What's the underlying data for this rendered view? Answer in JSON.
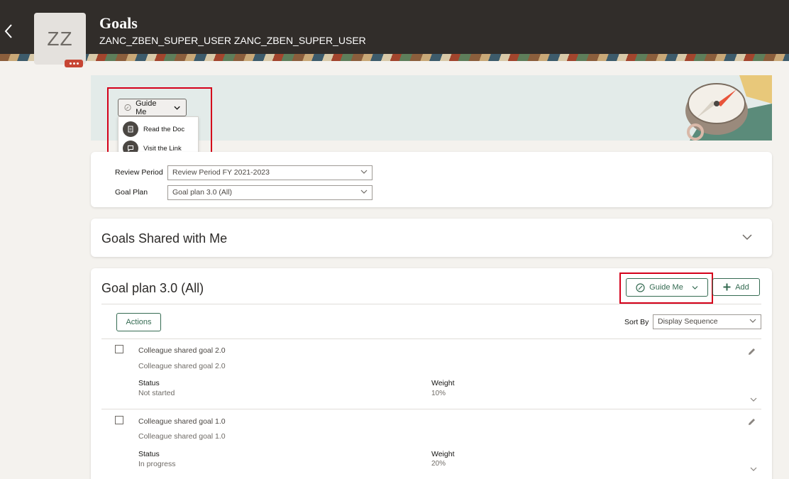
{
  "header": {
    "title": "Goals",
    "subtitle": "ZANC_ZBEN_SUPER_USER ZANC_ZBEN_SUPER_USER",
    "avatar_initials": "ZZ",
    "back_icon": "chevron-left-icon",
    "background_color": "#312d2a"
  },
  "guide_menu": {
    "button_label": "Guide Me",
    "items": [
      {
        "label": "Read the Doc",
        "icon": "document-icon"
      },
      {
        "label": "Visit the Link",
        "icon": "chat-icon"
      }
    ]
  },
  "filters": {
    "review_period_label": "Review Period",
    "review_period_value": "Review Period FY 2021-2023",
    "goal_plan_label": "Goal Plan",
    "goal_plan_value": "Goal plan 3.0 (All)"
  },
  "shared_section": {
    "title": "Goals Shared with Me"
  },
  "goal_plan_section": {
    "title": "Goal plan 3.0 (All)",
    "guide_label": "Guide Me",
    "add_label": "Add",
    "actions_label": "Actions",
    "sort_by_label": "Sort By",
    "sort_by_value": "Display Sequence",
    "accent_color": "#356b52",
    "goals": [
      {
        "name": "Colleague shared goal 2.0",
        "description": "Colleague shared goal 2.0",
        "status_label": "Status",
        "status_value": "Not started",
        "weight_label": "Weight",
        "weight_value": "10%"
      },
      {
        "name": "Colleague shared goal 1.0",
        "description": "Colleague shared goal 1.0",
        "status_label": "Status",
        "status_value": "In progress",
        "weight_label": "Weight",
        "weight_value": "20%"
      }
    ]
  },
  "highlight_color": "#d4001a"
}
